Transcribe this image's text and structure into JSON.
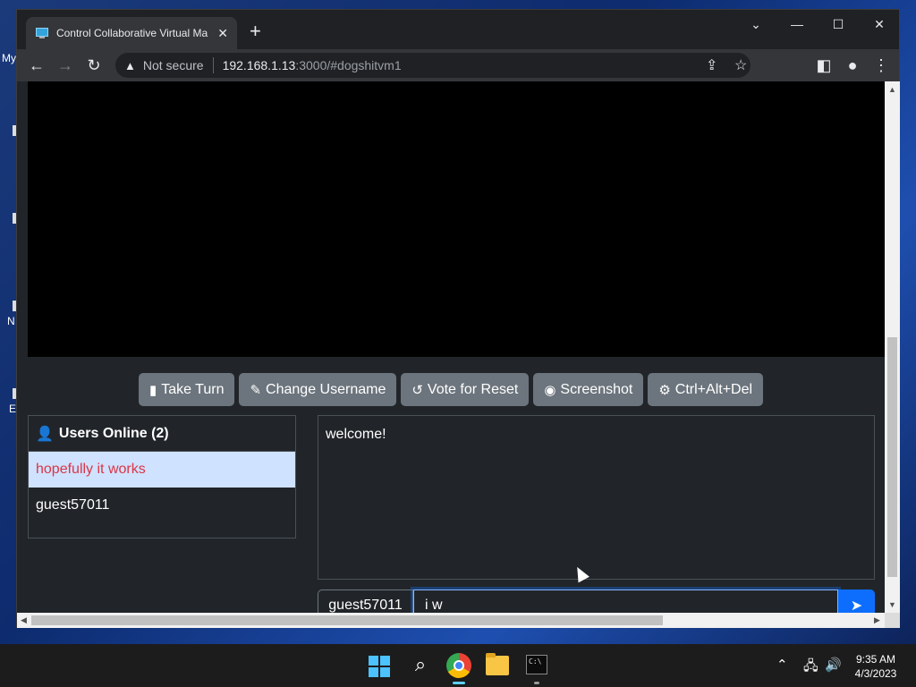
{
  "desktop": {
    "icon_labels": [
      "My",
      "N",
      "E"
    ]
  },
  "browser": {
    "tab_title": "Control Collaborative Virtual Ma",
    "tab_close": "✕",
    "new_tab": "+",
    "window_controls": {
      "dropdown": "⌄",
      "minimize": "—",
      "maximize": "☐",
      "close": "✕"
    },
    "security_label": "Not secure",
    "url_host": "192.168.1.13",
    "url_rest": ":3000/#dogshitvm1"
  },
  "controls": {
    "take_turn": "Take Turn",
    "change_username": "Change Username",
    "vote_reset": "Vote for Reset",
    "screenshot": "Screenshot",
    "ctrl_alt_del": "Ctrl+Alt+Del"
  },
  "users": {
    "header": "Users Online (2)",
    "list": [
      "hopefully it works",
      "guest57011"
    ]
  },
  "chat": {
    "messages": [
      "welcome!"
    ],
    "username": "guest57011",
    "input_value": "i w"
  },
  "taskbar": {
    "time": "9:35 AM",
    "date": "4/3/2023"
  },
  "colors": {
    "accent": "#0d6efd",
    "button": "#6c757d",
    "highlight_user_bg": "#cfe2ff",
    "highlight_user_text": "#dc3545"
  }
}
